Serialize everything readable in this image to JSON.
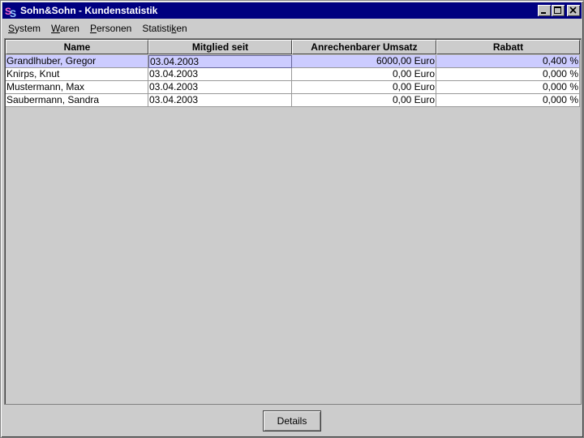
{
  "window": {
    "title": "Sohn&Sohn - Kundenstatistik"
  },
  "menubar": {
    "items": [
      {
        "mnemonic": "S",
        "rest": "ystem"
      },
      {
        "mnemonic": "W",
        "rest": "aren"
      },
      {
        "mnemonic": "P",
        "rest": "ersonen"
      },
      {
        "prefix": "Statisti",
        "mnemonic": "k",
        "rest": "en"
      }
    ]
  },
  "table": {
    "columns": [
      "Name",
      "Mitglied seit",
      "Anrechenbarer Umsatz",
      "Rabatt"
    ],
    "rows": [
      [
        "Grandlhuber, Gregor",
        "03.04.2003",
        "6000,00 Euro",
        "0,400 %"
      ],
      [
        "Knirps, Knut",
        "03.04.2003",
        "0,00 Euro",
        "0,000 %"
      ],
      [
        "Mustermann, Max",
        "03.04.2003",
        "0,00 Euro",
        "0,000 %"
      ],
      [
        "Saubermann, Sandra",
        "03.04.2003",
        "0,00 Euro",
        "0,000 %"
      ]
    ],
    "selected_row": 0
  },
  "buttons": {
    "details": "Details"
  },
  "colors": {
    "title_bar": "#000080",
    "selection": "#ccccff",
    "background": "#cccccc"
  }
}
